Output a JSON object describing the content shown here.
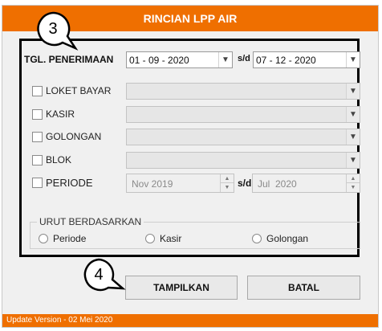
{
  "window": {
    "title": "RINCIAN LPP AIR"
  },
  "tgl": {
    "label": "TGL. PENERIMAAN",
    "from": "01 - 09 - 2020",
    "sd": "s/d",
    "to": "07 - 12 - 2020"
  },
  "filters": [
    {
      "label": "LOKET BAYAR",
      "value": ""
    },
    {
      "label": "KASIR",
      "value": ""
    },
    {
      "label": "GOLONGAN",
      "value": ""
    },
    {
      "label": "BLOK",
      "value": ""
    }
  ],
  "periode": {
    "label": "PERIODE",
    "from": "Nov 2019",
    "sd": "s/d",
    "to": "Jul  2020"
  },
  "urut": {
    "title": "URUT BERDASARKAN",
    "options": [
      "Periode",
      "Kasir",
      "Golongan"
    ]
  },
  "buttons": {
    "show": "TAMPILKAN",
    "cancel": "BATAL"
  },
  "footer": {
    "text": "Update Version - 02 Mei 2020"
  },
  "callouts": {
    "a": "3",
    "b": "4"
  }
}
